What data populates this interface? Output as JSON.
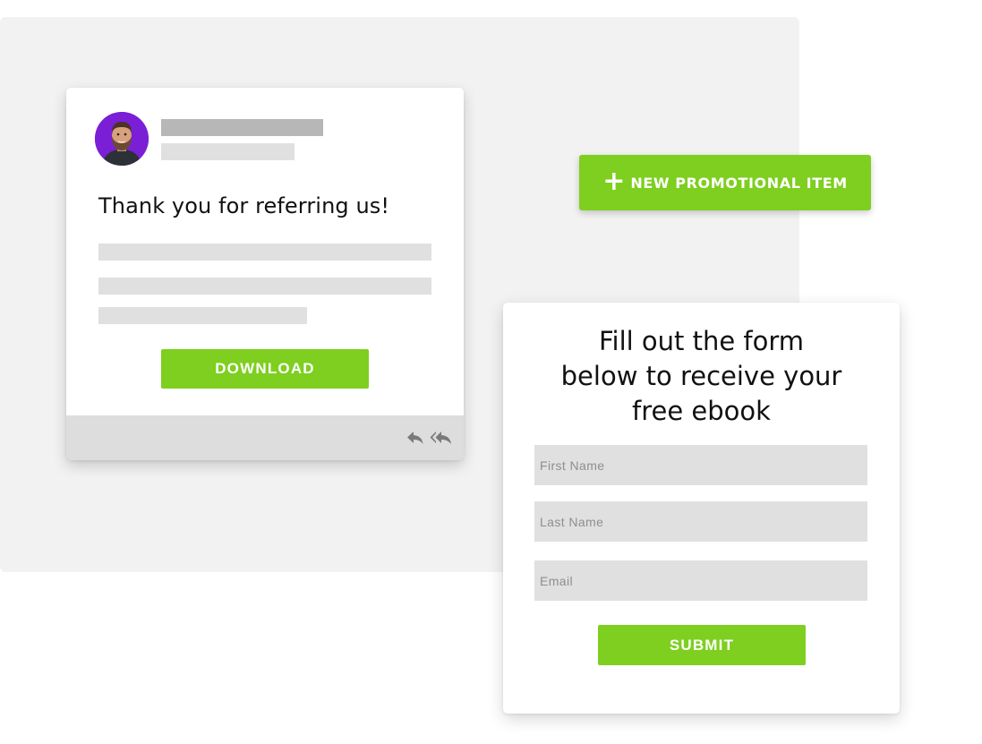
{
  "colors": {
    "accent_green": "#7ecf1f",
    "backdrop_gray": "#f2f2f2",
    "placeholder_bar_dark": "#b7b7b7",
    "placeholder_bar_light": "#e0e0e0",
    "footer_gray": "#dddddd",
    "avatar_purple": "#7b1fd6"
  },
  "email": {
    "avatar_icon": "user-avatar",
    "heading": "Thank you for referring us!",
    "download_label": "DOWNLOAD",
    "footer_icons": [
      "reply-icon",
      "reply-all-icon"
    ]
  },
  "promo": {
    "icon": "plus-icon",
    "label": "NEW PROMOTIONAL ITEM"
  },
  "form": {
    "title": "Fill out the form below to receive your free ebook",
    "fields": [
      {
        "placeholder": "First Name",
        "value": ""
      },
      {
        "placeholder": "Last Name",
        "value": ""
      },
      {
        "placeholder": "Email",
        "value": ""
      }
    ],
    "submit_label": "SUBMIT"
  }
}
